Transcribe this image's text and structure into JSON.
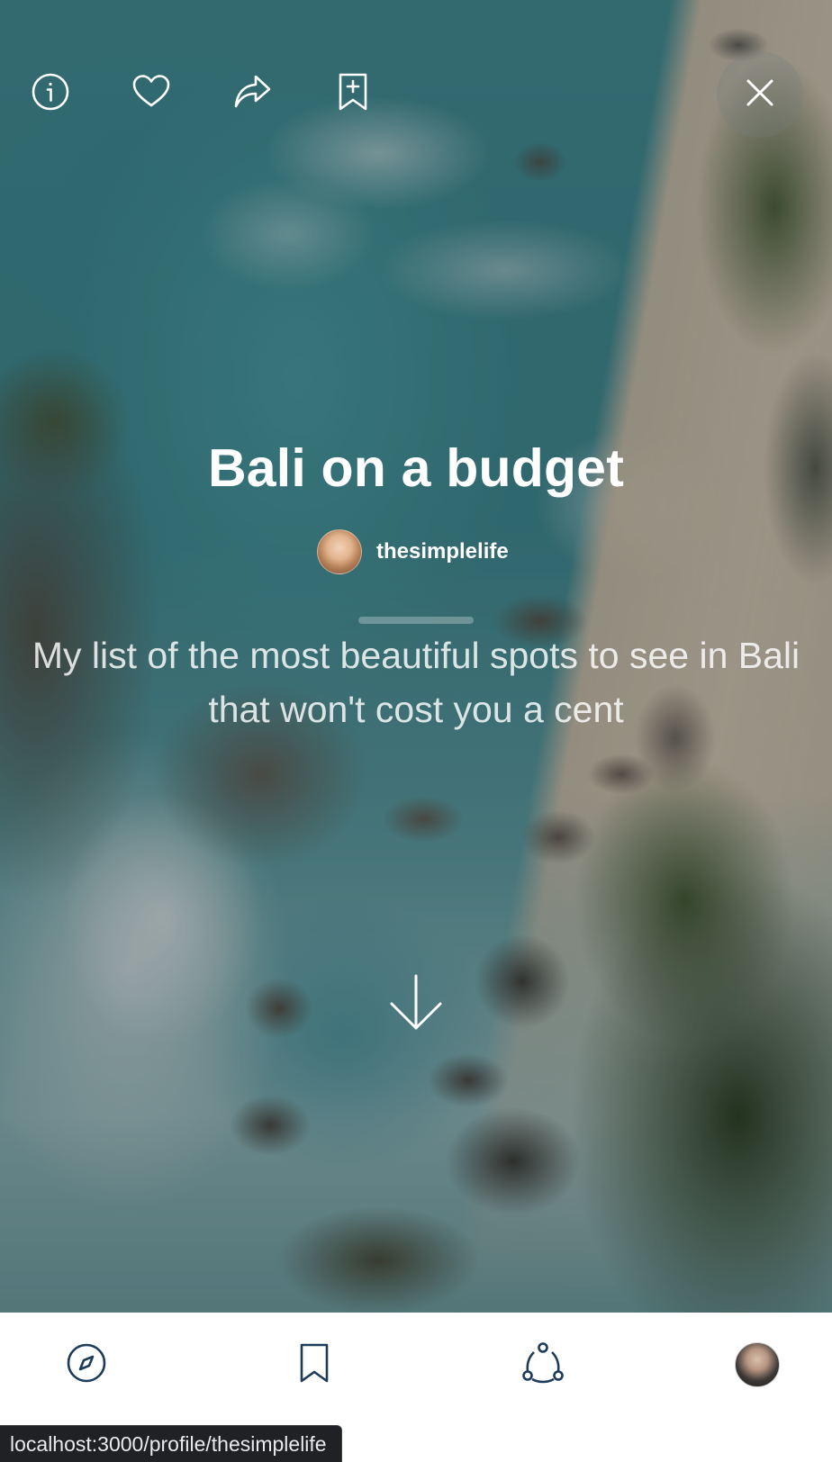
{
  "top_bar": {
    "info_icon": "info-icon",
    "like_icon": "heart-icon",
    "share_icon": "share-arrow-icon",
    "save_icon": "bookmark-plus-icon",
    "close_icon": "close-icon"
  },
  "list": {
    "title": "Bali on a budget",
    "author": "thesimplelife",
    "description": "My list of the most beautiful spots to see in Bali that won't cost you a cent"
  },
  "bottom_nav": {
    "items": [
      {
        "name": "explore",
        "icon": "compass-icon"
      },
      {
        "name": "saved",
        "icon": "bookmark-icon"
      },
      {
        "name": "network",
        "icon": "connections-icon"
      },
      {
        "name": "profile",
        "icon": "avatar"
      }
    ],
    "accent_color": "#1d3b5a"
  },
  "status_bar": {
    "url": "localhost:3000/profile/thesimplelife"
  }
}
